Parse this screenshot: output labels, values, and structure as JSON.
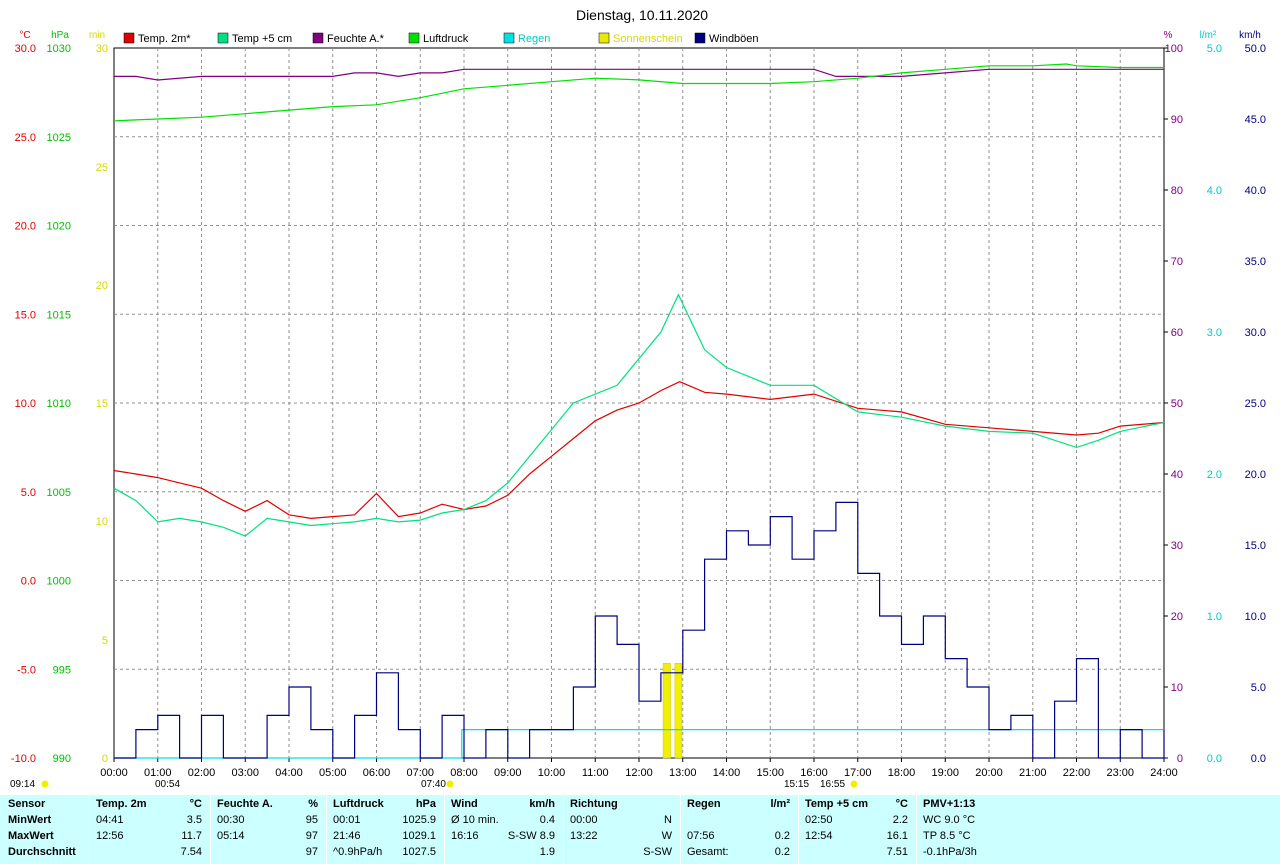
{
  "title": "Dienstag, 10.11.2020",
  "legend": [
    {
      "label": "Temp. 2m*",
      "color": "#e00000"
    },
    {
      "label": "Temp +5 cm",
      "color": "#00e080"
    },
    {
      "label": "Feuchte A.*",
      "color": "#800080"
    },
    {
      "label": "Luftdruck",
      "color": "#00e000"
    },
    {
      "label": "Regen",
      "color": "#00e0e0"
    },
    {
      "label": "Sonnenschein",
      "color": "#e8e800"
    },
    {
      "label": "Windböen",
      "color": "#000080"
    }
  ],
  "units": {
    "temp": "°C",
    "pressure": "hPa",
    "sun": "min",
    "humidity": "%",
    "rain": "l/m²",
    "wind": "km/h"
  },
  "axes": {
    "temp": {
      "ticks": [
        "30.0",
        "25.0",
        "20.0",
        "15.0",
        "10.0",
        "5.0",
        "0.0",
        "-5.0",
        "-10.0"
      ],
      "range": [
        -10,
        30
      ],
      "color": "#e00000"
    },
    "pressure": {
      "ticks": [
        "1030",
        "1025",
        "1020",
        "1015",
        "1010",
        "1005",
        "1000",
        "995",
        "990"
      ],
      "range": [
        990,
        1030
      ],
      "color": "#00c000"
    },
    "sun": {
      "ticks": [
        "30",
        "25",
        "20",
        "15",
        "10",
        "5",
        "0"
      ],
      "color": "#d8d800"
    },
    "humidity": {
      "ticks": [
        "100",
        "90",
        "80",
        "70",
        "60",
        "50",
        "40",
        "30",
        "20",
        "10",
        "0"
      ],
      "color": "#800080"
    },
    "rain": {
      "ticks": [
        "5.0",
        "4.0",
        "3.0",
        "2.0",
        "1.0",
        "0.0"
      ],
      "range": [
        0,
        5
      ],
      "color": "#00c8c8"
    },
    "wind": {
      "ticks": [
        "50.0",
        "45.0",
        "40.0",
        "35.0",
        "30.0",
        "25.0",
        "20.0",
        "15.0",
        "10.0",
        "5.0",
        "0.0"
      ],
      "range": [
        0,
        50
      ],
      "color": "#000080"
    },
    "time": {
      "ticks": [
        "00:00",
        "01:00",
        "02:00",
        "03:00",
        "04:00",
        "05:00",
        "06:00",
        "07:00",
        "08:00",
        "09:00",
        "10:00",
        "11:00",
        "12:00",
        "13:00",
        "14:00",
        "15:00",
        "16:00",
        "17:00",
        "18:00",
        "19:00",
        "20:00",
        "21:00",
        "22:00",
        "23:00",
        "24:00"
      ]
    }
  },
  "markers": {
    "sunrise": "07:40",
    "sunset": "16:55",
    "daylength": "09:14",
    "temp_min": "00:54",
    "temp_max": "15:15"
  },
  "chart_data": {
    "type": "line",
    "x_unit": "hour",
    "series": [
      {
        "name": "Temp. 2m*",
        "axis": "temp",
        "color": "#e00000",
        "x": [
          0,
          0.5,
          1,
          1.5,
          2,
          2.5,
          3,
          3.5,
          4,
          4.5,
          5,
          5.5,
          6,
          6.5,
          7,
          7.5,
          8,
          8.5,
          9,
          9.5,
          10,
          10.5,
          11,
          11.5,
          12,
          12.5,
          12.93,
          13.5,
          14,
          15,
          16,
          17,
          18,
          19,
          20,
          21,
          22,
          22.5,
          23,
          24
        ],
        "y": [
          6.2,
          6.0,
          5.8,
          5.5,
          5.2,
          4.5,
          3.9,
          4.5,
          3.7,
          3.5,
          3.6,
          3.7,
          4.9,
          3.6,
          3.8,
          4.3,
          4.0,
          4.2,
          4.8,
          6.0,
          7.0,
          8.0,
          9.0,
          9.6,
          10.0,
          10.7,
          11.2,
          10.6,
          10.5,
          10.2,
          10.5,
          9.7,
          9.5,
          8.8,
          8.6,
          8.4,
          8.2,
          8.3,
          8.7,
          8.9
        ]
      },
      {
        "name": "Temp +5 cm",
        "axis": "temp",
        "color": "#00e080",
        "x": [
          0,
          0.5,
          1,
          1.5,
          2,
          2.5,
          3,
          3.5,
          4,
          4.5,
          5,
          5.5,
          6,
          6.5,
          7,
          7.5,
          8,
          8.5,
          9,
          9.5,
          10,
          10.5,
          11,
          11.5,
          12,
          12.5,
          12.9,
          13.5,
          14,
          15,
          16,
          17,
          18,
          19,
          20,
          21,
          22,
          22.5,
          23,
          24
        ],
        "y": [
          5.2,
          4.5,
          3.3,
          3.5,
          3.3,
          3.0,
          2.5,
          3.5,
          3.3,
          3.1,
          3.2,
          3.3,
          3.5,
          3.3,
          3.4,
          3.8,
          4.0,
          4.5,
          5.5,
          7.0,
          8.5,
          10.0,
          10.5,
          11.0,
          12.5,
          14.0,
          16.1,
          13.0,
          12.0,
          11.0,
          11.0,
          9.5,
          9.2,
          8.7,
          8.4,
          8.3,
          7.5,
          7.9,
          8.4,
          8.9
        ]
      },
      {
        "name": "Feuchte A.*",
        "axis": "humidity",
        "color": "#800080",
        "x": [
          0,
          0.5,
          1,
          2,
          3,
          4,
          5,
          5.5,
          6,
          6.5,
          7,
          7.5,
          8,
          9,
          10,
          11,
          12,
          13,
          14,
          15,
          16,
          16.5,
          17,
          18,
          19,
          20,
          21,
          22,
          23,
          24
        ],
        "y": [
          96,
          96,
          95.5,
          96,
          96,
          96,
          96,
          96.5,
          96.5,
          96,
          96.5,
          96.5,
          97,
          97,
          97,
          97,
          97,
          97,
          97,
          97,
          97,
          96,
          96,
          96,
          96.5,
          97,
          97,
          97,
          97,
          97
        ]
      },
      {
        "name": "Luftdruck",
        "axis": "pressure",
        "color": "#00e000",
        "x": [
          0,
          1,
          2,
          3,
          4,
          5,
          6,
          7,
          8,
          9,
          10,
          11,
          12,
          13,
          14,
          15,
          16,
          17,
          18,
          19,
          20,
          21,
          21.77,
          22,
          23,
          24
        ],
        "y": [
          1025.9,
          1026.0,
          1026.1,
          1026.3,
          1026.5,
          1026.7,
          1026.8,
          1027.2,
          1027.7,
          1027.9,
          1028.1,
          1028.3,
          1028.2,
          1028.0,
          1028.0,
          1028.0,
          1028.1,
          1028.3,
          1028.6,
          1028.8,
          1029.0,
          1029.0,
          1029.1,
          1029.0,
          1028.9,
          1028.9
        ]
      },
      {
        "name": "Regen",
        "axis": "rain",
        "color": "#00e0e0",
        "x": [
          0,
          7.9,
          7.95,
          24
        ],
        "y": [
          0,
          0,
          0.2,
          0.2
        ]
      },
      {
        "name": "Windböen",
        "axis": "wind",
        "color": "#000080",
        "x": [
          0,
          0.5,
          1,
          1.5,
          2,
          2.5,
          3,
          3.5,
          4,
          4.5,
          5,
          5.5,
          6,
          6.5,
          7,
          7.5,
          8,
          8.5,
          9,
          9.5,
          10,
          10.5,
          11,
          11.5,
          12,
          12.5,
          13,
          13.5,
          14,
          14.5,
          15,
          15.5,
          16,
          16.5,
          17,
          17.5,
          18,
          18.5,
          19,
          19.5,
          20,
          20.5,
          21,
          21.5,
          22,
          22.5,
          23,
          23.5,
          24
        ],
        "y": [
          0,
          2,
          3,
          0,
          3,
          0,
          0,
          3,
          5,
          2,
          0,
          3,
          6,
          2,
          0,
          3,
          0,
          2,
          0,
          2,
          2,
          5,
          10,
          8,
          4,
          6,
          9,
          14,
          16,
          15,
          17,
          14,
          16,
          18,
          13,
          10,
          8,
          10,
          7,
          5,
          2,
          3,
          0,
          4,
          7,
          0,
          2,
          0,
          2
        ]
      }
    ],
    "sunshine_bars": [
      {
        "x": [
          12.55,
          12.72
        ],
        "value": 4
      },
      {
        "x": [
          12.82,
          12.98
        ],
        "value": 4
      }
    ]
  },
  "stats": {
    "columns": [
      {
        "header": "Sensor",
        "unit": "",
        "rows": [
          [
            "Sensor",
            ""
          ],
          [
            "MinWert",
            ""
          ],
          [
            "MaxWert",
            ""
          ],
          [
            "Durchschnitt",
            ""
          ]
        ]
      },
      {
        "header": "Temp. 2m",
        "unit": "°C",
        "rows": [
          [
            "04:41",
            "3.5"
          ],
          [
            "12:56",
            "11.7"
          ],
          [
            "",
            "7.54"
          ]
        ]
      },
      {
        "header": "Feuchte A.",
        "unit": "%",
        "rows": [
          [
            "00:30",
            "95"
          ],
          [
            "05:14",
            "97"
          ],
          [
            "",
            "97"
          ]
        ]
      },
      {
        "header": "Luftdruck",
        "unit": "hPa",
        "rows": [
          [
            "00:01",
            "1025.9"
          ],
          [
            "21:46",
            "1029.1"
          ],
          [
            "^0.9hPa/h",
            "1027.5"
          ]
        ]
      },
      {
        "header": "Wind",
        "unit": "km/h",
        "rows": [
          [
            "Ø 10 min.",
            "0.4"
          ],
          [
            "16:16",
            "S-SW 8.9"
          ],
          [
            "",
            "1.9"
          ]
        ]
      },
      {
        "header": "Richtung",
        "unit": "",
        "rows": [
          [
            "00:00",
            "N"
          ],
          [
            "13:22",
            "W"
          ],
          [
            "",
            "S-SW"
          ]
        ]
      },
      {
        "header": "Regen",
        "unit": "l/m²",
        "rows": [
          [
            "",
            ""
          ],
          [
            "07:56",
            "0.2"
          ],
          [
            "Gesamt:",
            "0.2"
          ]
        ]
      },
      {
        "header": "Temp +5 cm",
        "unit": "°C",
        "rows": [
          [
            "02:50",
            "2.2"
          ],
          [
            "12:54",
            "16.1"
          ],
          [
            "",
            "7.51"
          ]
        ]
      },
      {
        "header": "PMV+1:13",
        "unit": "",
        "rows": [
          [
            "WC 9.0 °C",
            ""
          ],
          [
            "TP 8.5 °C",
            ""
          ],
          [
            "-0.1hPa/3h",
            ""
          ]
        ]
      }
    ]
  }
}
